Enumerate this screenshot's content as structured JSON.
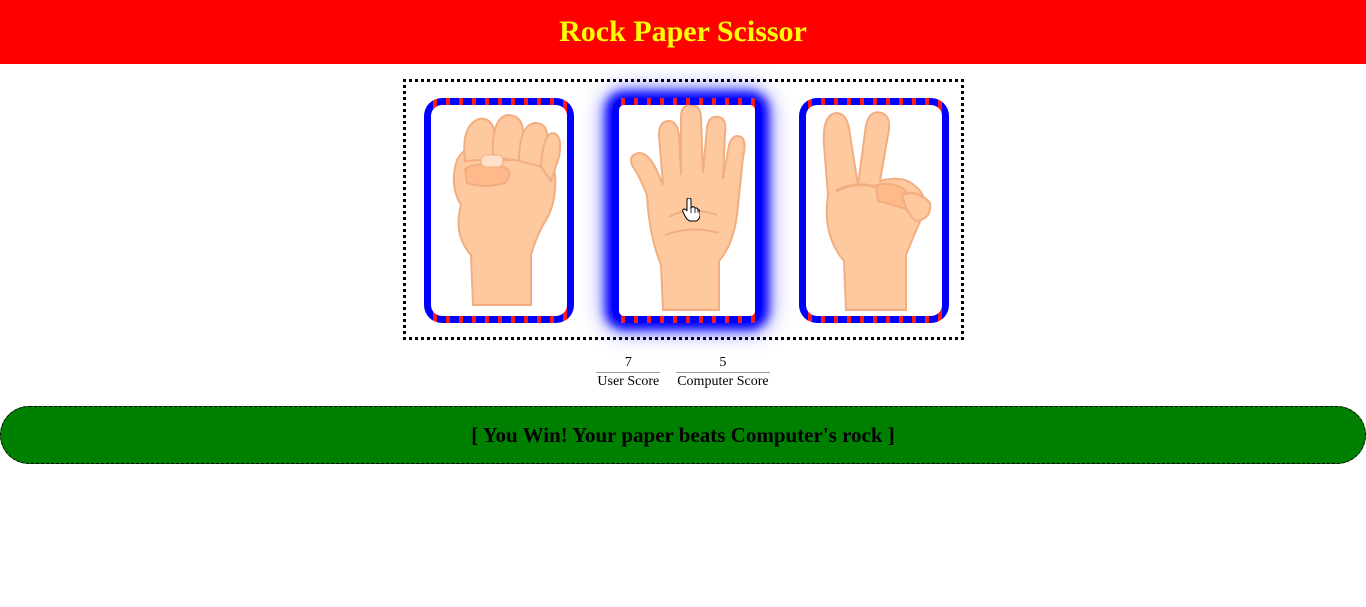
{
  "header": {
    "title": "Rock Paper Scissor"
  },
  "choices": [
    {
      "name": "rock",
      "icon": "rock-hand-icon",
      "selected": false
    },
    {
      "name": "paper",
      "icon": "paper-hand-icon",
      "selected": true
    },
    {
      "name": "scissors",
      "icon": "scissors-hand-icon",
      "selected": false
    }
  ],
  "scores": {
    "user": {
      "value": "7",
      "label": "User Score"
    },
    "computer": {
      "value": "5",
      "label": "Computer Score"
    }
  },
  "result": {
    "message": "[ You Win! Your paper beats Computer's rock ]"
  },
  "colors": {
    "header_bg": "#ff0000",
    "title": "#ffff00",
    "card_border_primary": "#0000ff",
    "card_border_secondary": "#ff1a1a",
    "result_bg": "#008000",
    "skin": "#ffc9a0",
    "skin_shadow": "#f2ad80"
  }
}
